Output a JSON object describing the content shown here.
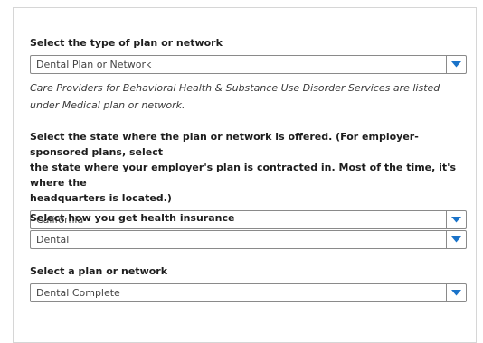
{
  "colors": {
    "accent": "#1a73c9",
    "border": "#8a8a8a",
    "card_border": "#d6d6d6"
  },
  "plan_type": {
    "label": "Select the type of plan or network",
    "value": "Dental Plan or Network",
    "note_line1": "Care Providers for Behavioral Health & Substance Use Disorder Services are listed",
    "note_line2": "under Medical plan or network."
  },
  "state": {
    "label_line1": "Select the state where the plan or network is offered. (For employer-sponsored plans, select",
    "label_line2": "the state where your employer's plan is contracted in. Most of the time, it's where the",
    "label_line3": "headquarters is located.)",
    "value": "California"
  },
  "insurance_source": {
    "label": "Select how you get health insurance",
    "value": "Dental"
  },
  "plan": {
    "label": "Select a plan or network",
    "value": "Dental Complete"
  },
  "icons": {
    "dropdown": "chevron-down-icon"
  }
}
